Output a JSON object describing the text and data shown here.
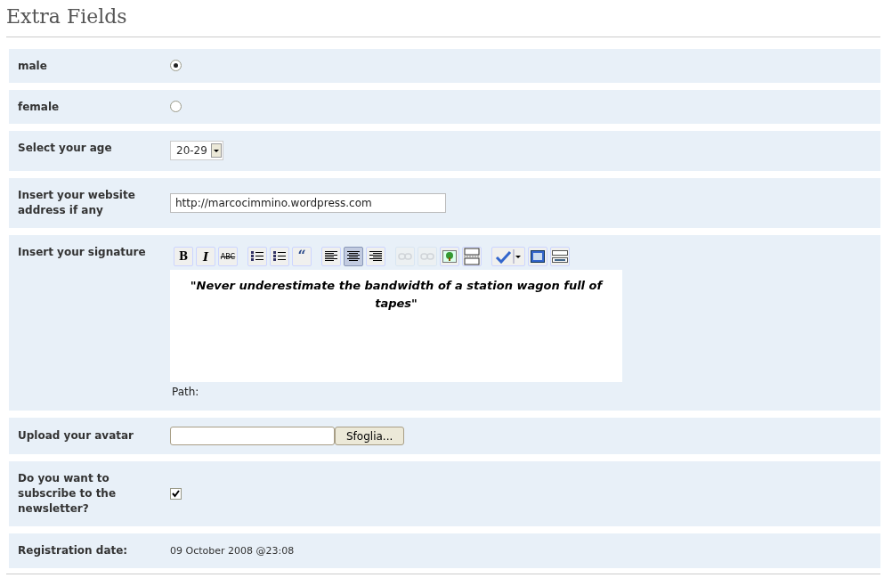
{
  "title": "Extra Fields",
  "rows": [
    {
      "kind": "radio",
      "label": "male",
      "selected": true
    },
    {
      "kind": "radio",
      "label": "female",
      "selected": false
    },
    {
      "kind": "select",
      "label": "Select your age",
      "value": "20-29"
    },
    {
      "kind": "text",
      "label": "Insert your website address if any",
      "value": "http://marcocimmino.wordpress.com"
    },
    {
      "kind": "editor",
      "label": "Insert your signature",
      "content": "\"Never underestimate the bandwidth of a station wagon full of tapes\"",
      "path_label": "Path:",
      "toolbar": [
        {
          "kind": "bold",
          "label": "B",
          "selected": false,
          "disabled": false
        },
        {
          "kind": "italic",
          "label": "I",
          "selected": false,
          "disabled": false
        },
        {
          "kind": "strike",
          "label": "ABC",
          "selected": false,
          "disabled": false
        },
        {
          "kind": "sep"
        },
        {
          "kind": "bullets",
          "selected": false,
          "disabled": false
        },
        {
          "kind": "numbers",
          "selected": false,
          "disabled": false
        },
        {
          "kind": "quote",
          "label": "“",
          "selected": false,
          "disabled": false
        },
        {
          "kind": "sep"
        },
        {
          "kind": "align-left",
          "selected": false,
          "disabled": false
        },
        {
          "kind": "align-center",
          "selected": true,
          "disabled": false
        },
        {
          "kind": "align-right",
          "selected": false,
          "disabled": false
        },
        {
          "kind": "sep"
        },
        {
          "kind": "link",
          "selected": false,
          "disabled": true
        },
        {
          "kind": "unlink",
          "selected": false,
          "disabled": true
        },
        {
          "kind": "image",
          "selected": false,
          "disabled": false
        },
        {
          "kind": "pagebreak",
          "selected": false,
          "disabled": false
        },
        {
          "kind": "sep"
        },
        {
          "kind": "spell",
          "selected": false,
          "disabled": false
        },
        {
          "kind": "window",
          "selected": false,
          "disabled": false
        },
        {
          "kind": "grid",
          "selected": false,
          "disabled": false
        }
      ]
    },
    {
      "kind": "file",
      "label": "Upload your avatar",
      "button": "Sfoglia..."
    },
    {
      "kind": "checkbox",
      "label": "Do you want to subscribe to the newsletter?",
      "checked": true
    },
    {
      "kind": "static",
      "label": "Registration date:",
      "value": "09 October 2008 @23:08"
    }
  ]
}
